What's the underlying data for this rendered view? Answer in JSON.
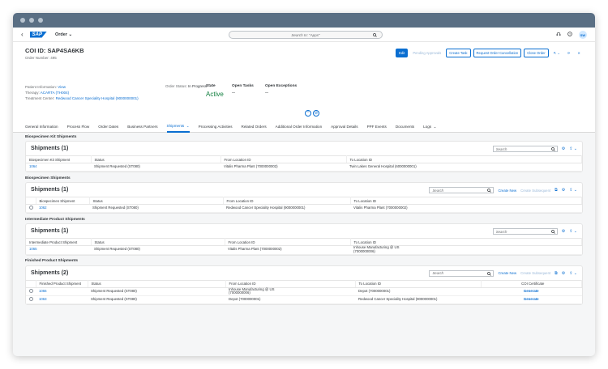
{
  "shell": {
    "app_title": "Order",
    "search_placeholder": "Search In: \"Apps\"",
    "avatar_initials": "SW"
  },
  "header": {
    "title": "COI ID:  SAP4SA6KB",
    "order_number": "Order Number: 495",
    "actions": {
      "edit": "Edit",
      "pending_approvals": "Pending Approvals",
      "create_task": "Create Task",
      "request_cancel": "Request Order Cancellation",
      "close_order": "Close Order"
    },
    "patient_label": "Patient Information:",
    "patient_value": "View",
    "therapy_label": "Therapy:",
    "therapy_value": "ACARTA (TH004)",
    "treatment_label": "Treatment Center:",
    "treatment_value": "Redwood Cancer Speciality Hospital (9000000001)",
    "order_status_label": "Order Status:",
    "order_status_value": "In Progress",
    "state_label": "State",
    "state_value": "Active",
    "open_tasks_label": "Open Tasks",
    "open_tasks_value": "--",
    "open_exceptions_label": "Open Exceptions",
    "open_exceptions_value": "--"
  },
  "tabs": [
    "General Information",
    "Process Flow",
    "Order Dates",
    "Business Partners",
    "Shipments",
    "Processing Activities",
    "Related Orders",
    "Additional Order Information",
    "Approval Details",
    "PPF Events",
    "Documents",
    "Logs"
  ],
  "toolbar": {
    "search_placeholder": "Search",
    "create_new": "Create New",
    "create_subsequent": "Create Subsequent"
  },
  "sections": {
    "kit": {
      "heading": "Biospecimen Kit Shipments",
      "card_title": "Shipments (1)",
      "columns": [
        "Biospecimen Kit Shipment",
        "Status",
        "From Location ID",
        "To Location ID"
      ],
      "row": [
        "1064",
        "Shipment Requested (ST080)",
        "Vitalis Pharma Plant (7000000002)",
        "Twin Lakes General Hospital (6000000001)"
      ]
    },
    "bio": {
      "heading": "Biospecimen Shipments",
      "card_title": "Shipments (1)",
      "columns": [
        "Biospecimen Shipment",
        "Status",
        "From Location ID",
        "To Location ID"
      ],
      "row": [
        "1062",
        "Shipment Requested (ST080)",
        "Redwood Cancer Speciality Hospital (9000000001)",
        "Vitalis Pharma Plant (7000000002)"
      ]
    },
    "intermediate": {
      "heading": "Intermediate Product Shipments",
      "card_title": "Shipments (1)",
      "columns": [
        "Intermediate Product Shipment",
        "Status",
        "From Location ID",
        "To Location ID"
      ],
      "row": [
        "1065",
        "Shipment Requested (ST080)",
        "Vitalis Pharma Plant (7000000002)",
        "Inhouse Manufacturing @ US",
        "(7000000006)"
      ]
    },
    "finished": {
      "heading": "Finished Product Shipments",
      "card_title": "Shipments (2)",
      "columns": [
        "Finished Product Shipment",
        "Status",
        "From Location ID",
        "To Location ID",
        "COI Certificate"
      ],
      "rows": [
        {
          "id": "1066",
          "status": "Shipment Requested (ST080)",
          "from1": "Inhouse Manufacturing @ US",
          "from2": "(7000000006)",
          "to": "Depot (7000000001)",
          "cert": "Generate"
        },
        {
          "id": "1063",
          "status": "Shipment Requested (ST080)",
          "from1": "Depot (7000000001)",
          "from2": "",
          "to": "Redwood Cancer Speciality Hospital (9000000001)",
          "cert": "Generate"
        }
      ]
    }
  }
}
